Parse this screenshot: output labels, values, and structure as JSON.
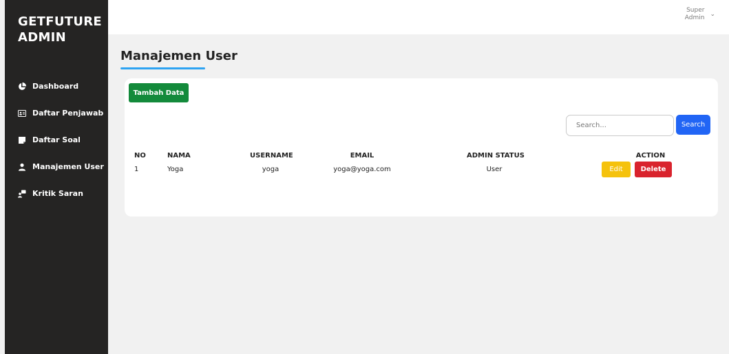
{
  "brand": {
    "line1": "GETFUTURE",
    "line2": "ADMIN"
  },
  "sidebar": {
    "items": [
      {
        "label": "Dashboard",
        "icon": "pie-chart-icon"
      },
      {
        "label": "Daftar Penjawab",
        "icon": "id-card-icon"
      },
      {
        "label": "Daftar Soal",
        "icon": "note-icon"
      },
      {
        "label": "Manajemen User",
        "icon": "user-icon"
      },
      {
        "label": "Kritik Saran",
        "icon": "chat-icon"
      }
    ]
  },
  "topbar": {
    "user_line1": "Super",
    "user_line2": "Admin"
  },
  "page": {
    "title": "Manajemen User"
  },
  "toolbar": {
    "add_label": "Tambah Data",
    "search_placeholder": "Search...",
    "search_label": "Search"
  },
  "table": {
    "headers": {
      "no": "NO",
      "nama": "NAMA",
      "username": "USERNAME",
      "email": "EMAIL",
      "status": "ADMIN STATUS",
      "action": "ACTION"
    },
    "rows": [
      {
        "no": "1",
        "nama": "Yoga",
        "username": "yoga",
        "email": "yoga@yoga.com",
        "status": "User",
        "edit_label": "Edit",
        "delete_label": "Delete"
      }
    ]
  },
  "colors": {
    "sidebar": "#252423",
    "accent": "#2ea3f2",
    "add": "#138a3b",
    "search": "#2165f5",
    "edit": "#f5c20d",
    "delete": "#d9232d"
  }
}
